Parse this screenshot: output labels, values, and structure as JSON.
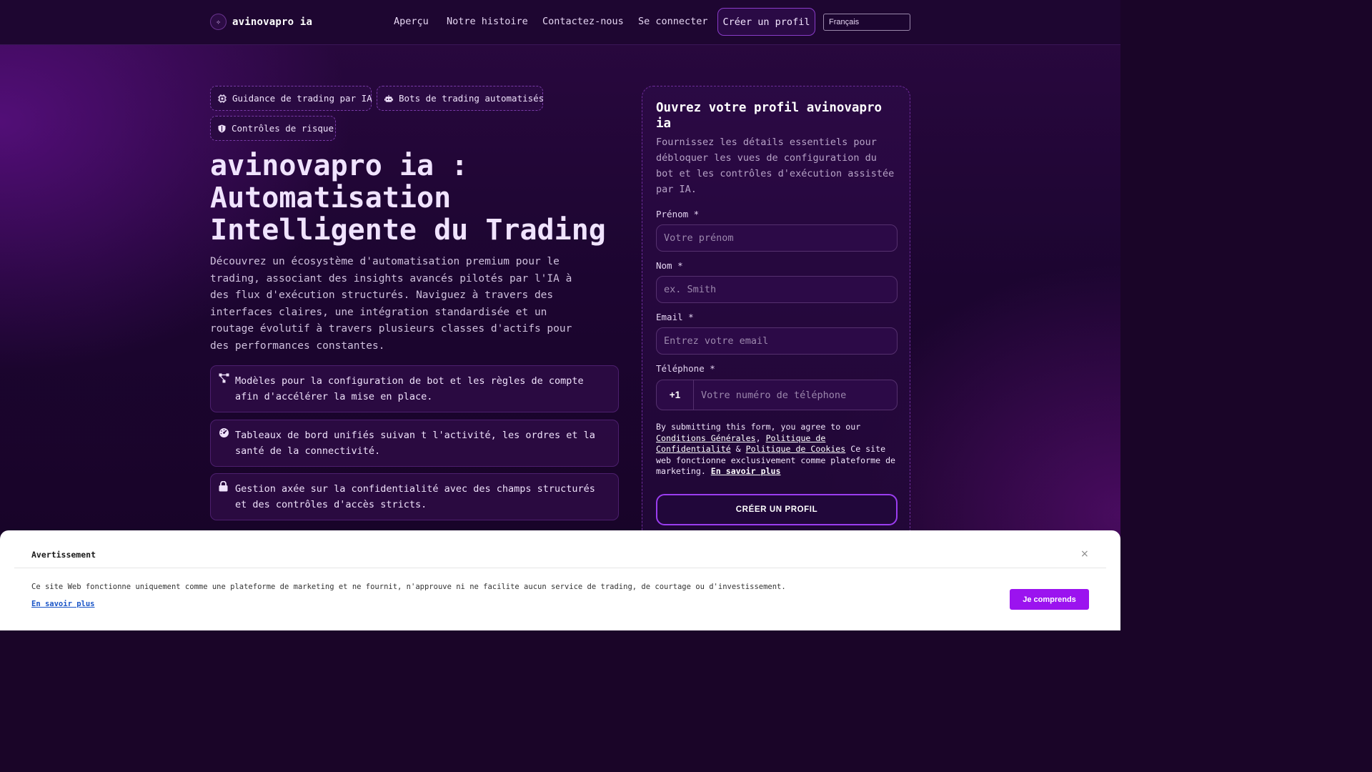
{
  "header": {
    "brand": "avinovapro ia",
    "nav": [
      "Aperçu",
      "Notre histoire",
      "Contactez-nous",
      "Se connecter"
    ],
    "cta": "Créer un profil",
    "language": "Français"
  },
  "hero": {
    "chips": [
      "Guidance de trading par IA",
      "Bots de trading automatisés",
      "Contrôles de risque"
    ],
    "title": "avinovapro ia : Automatisation Intelligente du Trading",
    "description": "Découvrez un écosystème d'automatisation premium pour le trading, associant des insights avancés pilotés par l'IA à des flux d'exécution structurés. Naviguez à travers des interfaces claires, une intégration standardisée et un routage évolutif à travers plusieurs classes d'actifs pour des performances constantes.",
    "features": [
      "Modèles pour la configuration de bot et les règles de compte afin d'accélérer la mise en place.",
      "Tableaux de bord unifiés suivan t l'activité, les ordres et la santé de la connectivité.",
      "Gestion axée sur la confidentialité avec des champs structurés et des contrôles d'accès stricts."
    ]
  },
  "form": {
    "title": "Ouvrez votre profil avinovapro ia",
    "subtitle": "Fournissez les détails essentiels pour débloquer les vues de configuration du bot et les contrôles d'exécution assistée par IA.",
    "first_name_label": "Prénom *",
    "first_name_placeholder": "Votre prénom",
    "last_name_label": "Nom *",
    "last_name_placeholder": "ex. Smith",
    "email_label": "Email *",
    "email_placeholder": "Entrez votre email",
    "phone_label": "Téléphone *",
    "phone_code": "+1",
    "phone_placeholder": "Votre numéro de téléphone",
    "consent_prefix": "By submitting this form, you agree to our ",
    "terms_link": "Conditions Générales",
    "consent_sep1": ", ",
    "privacy_link": "Politique de Confidentialité",
    "consent_sep2": " & ",
    "cookies_link": "Politique de Cookies",
    "consent_suffix": " Ce site web fonctionne exclusivement comme plateforme de marketing. ",
    "learn_more": "En savoir plus",
    "submit": "CRÉER UN PROFIL"
  },
  "banner": {
    "title": "Avertissement",
    "close": "×",
    "text": "Ce site Web fonctionne uniquement comme une plateforme de marketing et ne fournit, n'approuve ni ne facilite aucun service de trading, de courtage ou d'investissement.",
    "link": "En savoir plus",
    "button": "Je comprends"
  },
  "colors": {
    "accent": "#9b13ef",
    "background": "#1a0528"
  }
}
